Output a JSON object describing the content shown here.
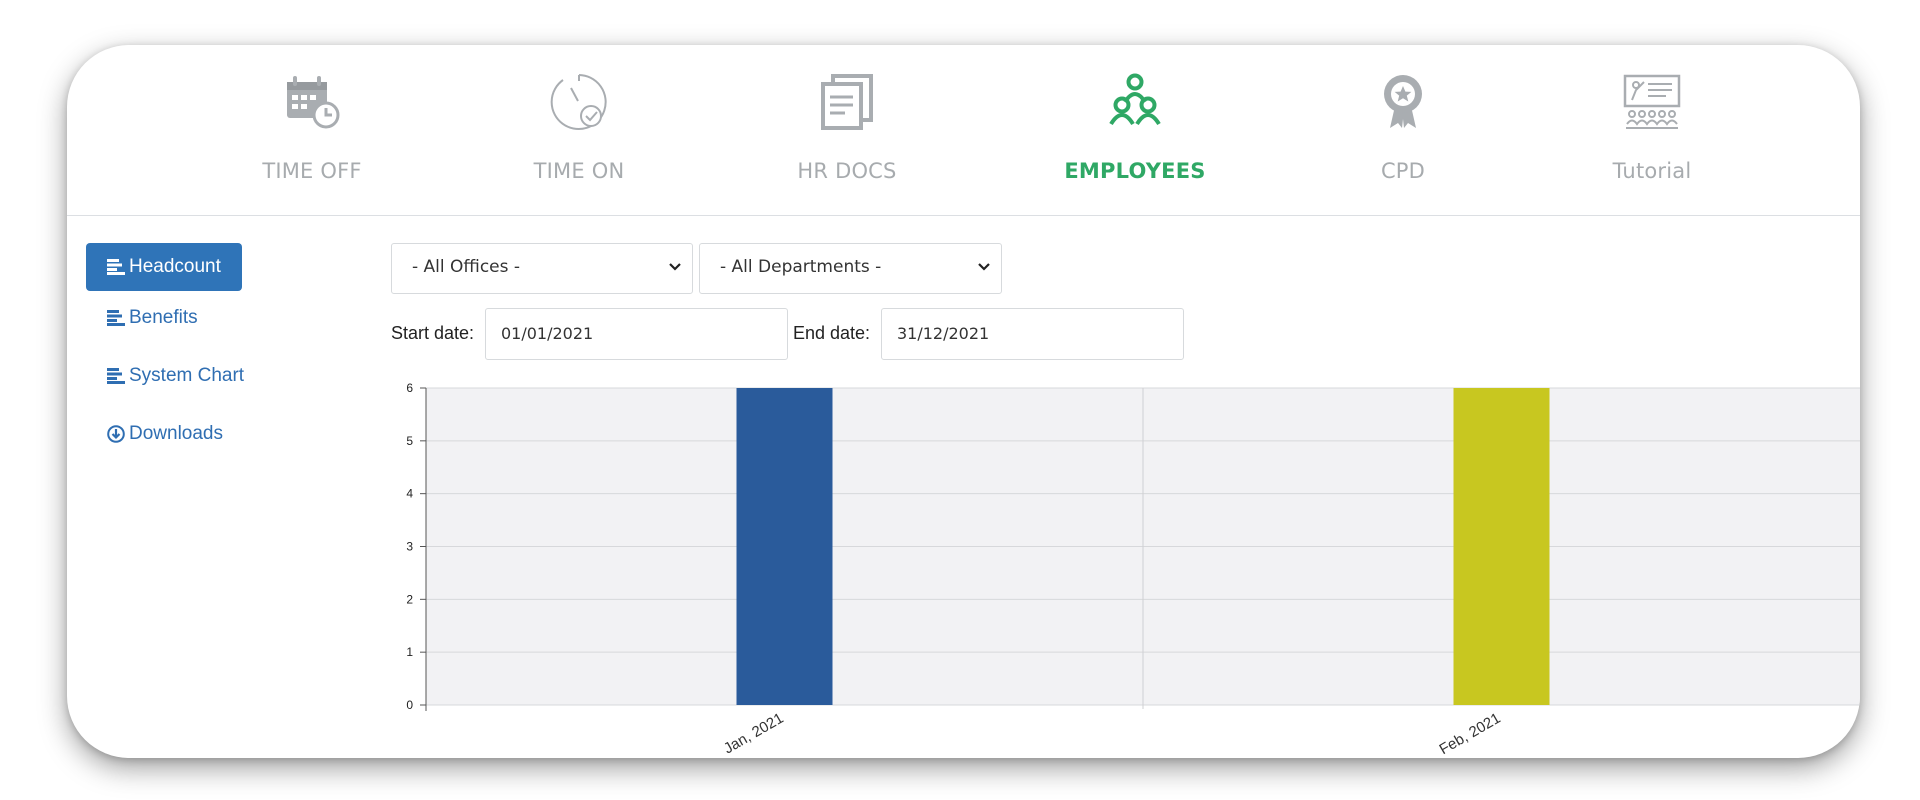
{
  "nav": {
    "tabs": [
      {
        "label": "TIME OFF",
        "icon": "calendar-clock-icon"
      },
      {
        "label": "TIME ON",
        "icon": "stopwatch-check-icon"
      },
      {
        "label": "HR DOCS",
        "icon": "documents-icon"
      },
      {
        "label": "EMPLOYEES",
        "icon": "employees-group-icon",
        "active": true
      },
      {
        "label": "CPD",
        "icon": "award-ribbon-icon"
      },
      {
        "label": "Tutorial",
        "icon": "presentation-icon"
      }
    ]
  },
  "sidebar": {
    "items": [
      {
        "label": "Headcount",
        "icon": "bars-icon",
        "active": true
      },
      {
        "label": "Benefits",
        "icon": "bars-icon"
      },
      {
        "label": "System Chart",
        "icon": "bars-icon"
      },
      {
        "label": "Downloads",
        "icon": "download-circle-icon"
      }
    ]
  },
  "filters": {
    "office": "- All Offices -",
    "department": "- All Departments -",
    "start_label": "Start date:",
    "start_value": "01/01/2021",
    "end_label": "End date:",
    "end_value": "31/12/2021"
  },
  "colors": {
    "accent_green": "#2fa865",
    "nav_inactive": "#a7abae",
    "link_blue": "#2f6eb2",
    "active_button": "#2f74b8"
  },
  "chart_data": {
    "type": "bar",
    "categories": [
      "Jan, 2021",
      "Feb, 2021"
    ],
    "values": [
      6,
      6
    ],
    "colors": [
      "#2a5b9b",
      "#c8c720"
    ],
    "ylim": [
      0,
      6
    ],
    "yticks": [
      0,
      1,
      2,
      3,
      4,
      5,
      6
    ],
    "grid": true
  }
}
